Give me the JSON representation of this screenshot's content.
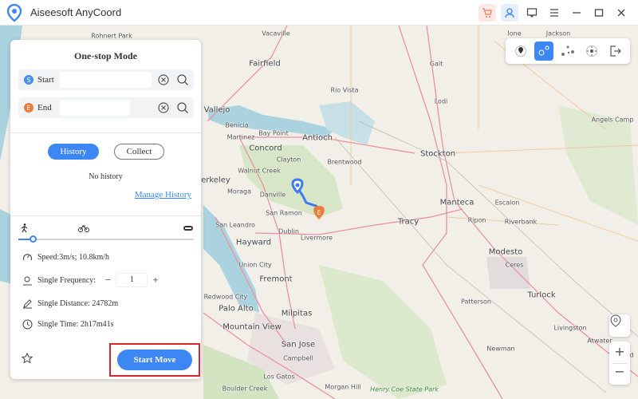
{
  "app": {
    "title": "Aiseesoft AnyCoord",
    "icon": "location-pin-logo-icon"
  },
  "titlebar": {
    "buttons": [
      "cart-icon",
      "user-icon",
      "feedback-icon",
      "menu-icon",
      "minimize-icon",
      "maximize-icon",
      "close-icon"
    ]
  },
  "colors": {
    "accent": "#3d87f5",
    "start_pin": "#4a8ff0",
    "end_pin": "#f07a3a",
    "highlight_border": "#d7262b",
    "route": "#3d7cf0",
    "water": "#aad3df",
    "land": "#f2efe9"
  },
  "panel": {
    "title": "One-stop Mode",
    "start": {
      "label": "Start",
      "value": "",
      "icon_letter": "S"
    },
    "end": {
      "label": "End",
      "value": "",
      "icon_letter": "E"
    },
    "tabs": {
      "history": "History",
      "collect": "Collect",
      "active": "History"
    },
    "no_history": "No history",
    "manage_history": "Manage History",
    "speed_modes": [
      "walk-icon",
      "bike-icon",
      "car-icon"
    ],
    "speed_slider_percent": 8,
    "speed": "Speed:3m/s; 10.8km/h",
    "frequency_label": "Single Frequency:",
    "frequency_value": "1",
    "distance": "Single Distance: 24782m",
    "time": "Single Time: 2h17m41s",
    "start_move": "Start Move"
  },
  "modebar": {
    "modes": [
      "teleport-icon",
      "one-stop-icon",
      "multi-stop-icon",
      "joystick-icon",
      "exit-icon"
    ],
    "active": "one-stop-icon"
  },
  "map": {
    "labels": [
      "Rohnert Park",
      "Vacaville",
      "Fairfield",
      "Rio Vista",
      "Galt",
      "Lodi",
      "Ione",
      "Jackson",
      "Angels Camp",
      "Vallejo",
      "Benicia",
      "Martinez",
      "Bay Point",
      "Antioch",
      "Concord",
      "Clayton",
      "Brentwood",
      "Stockton",
      "Walnut Creek",
      "Berkeley",
      "Moraga",
      "Danville",
      "Manteca",
      "Escalon",
      "San Ramon",
      "Tracy",
      "Ripon",
      "Riverbank",
      "San Leandro",
      "Dublin",
      "Livermore",
      "Hayward",
      "Modesto",
      "Ceres",
      "Union City",
      "Fremont",
      "Turlock",
      "Redwood City",
      "Patterson",
      "Palo Alto",
      "Milpitas",
      "Mountain View",
      "Livingston",
      "San Jose",
      "Newman",
      "Campbell",
      "Atwater",
      "Merced",
      "Los Gatos",
      "Henry Coe State Park",
      "Boulder Creek",
      "Morgan Hill"
    ],
    "controls": {
      "zoom_in": "+",
      "zoom_out": "−",
      "recenter": "locate-icon"
    }
  }
}
